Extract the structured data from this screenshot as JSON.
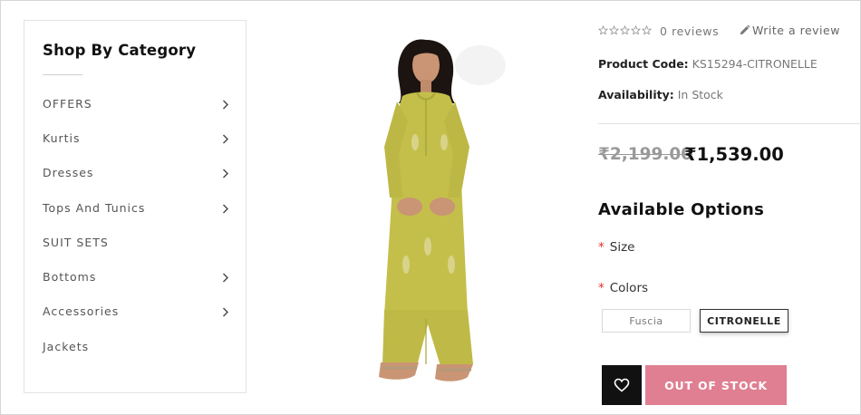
{
  "sidebar": {
    "title": "Shop By Category",
    "items": [
      {
        "label": "OFFERS",
        "has_submenu": true
      },
      {
        "label": "Kurtis",
        "has_submenu": true
      },
      {
        "label": "Dresses",
        "has_submenu": true
      },
      {
        "label": "Tops And Tunics",
        "has_submenu": true
      },
      {
        "label": "SUIT SETS",
        "has_submenu": false
      },
      {
        "label": "Bottoms",
        "has_submenu": true
      },
      {
        "label": "Accessories",
        "has_submenu": true
      },
      {
        "label": "Jackets",
        "has_submenu": false
      }
    ]
  },
  "product": {
    "image_icon": "woman-in-yellow-kurta-photo",
    "rating": {
      "stars_filled": 0,
      "stars_total": 5,
      "reviews_text": "0 reviews"
    },
    "write_review": "Write a review",
    "code_label": "Product Code:",
    "code_value": "KS15294-CITRONELLE",
    "availability_label": "Availability:",
    "availability_value": "In Stock",
    "old_price": "₹2,199.00",
    "new_price": "₹1,539.00"
  },
  "options": {
    "title": "Available Options",
    "required_marker": "*",
    "size_label": "Size",
    "colors_label": "Colors",
    "colors": [
      {
        "label": "Fuscia",
        "selected": false
      },
      {
        "label": "CITRONELLE",
        "selected": true
      }
    ]
  },
  "actions": {
    "wishlist_icon": "heart-icon",
    "stock_button": "OUT OF STOCK"
  },
  "colors": {
    "accent_pink": "#e07f92",
    "required_red": "#e03030",
    "kurta_yellow": "#c4bf4a"
  }
}
